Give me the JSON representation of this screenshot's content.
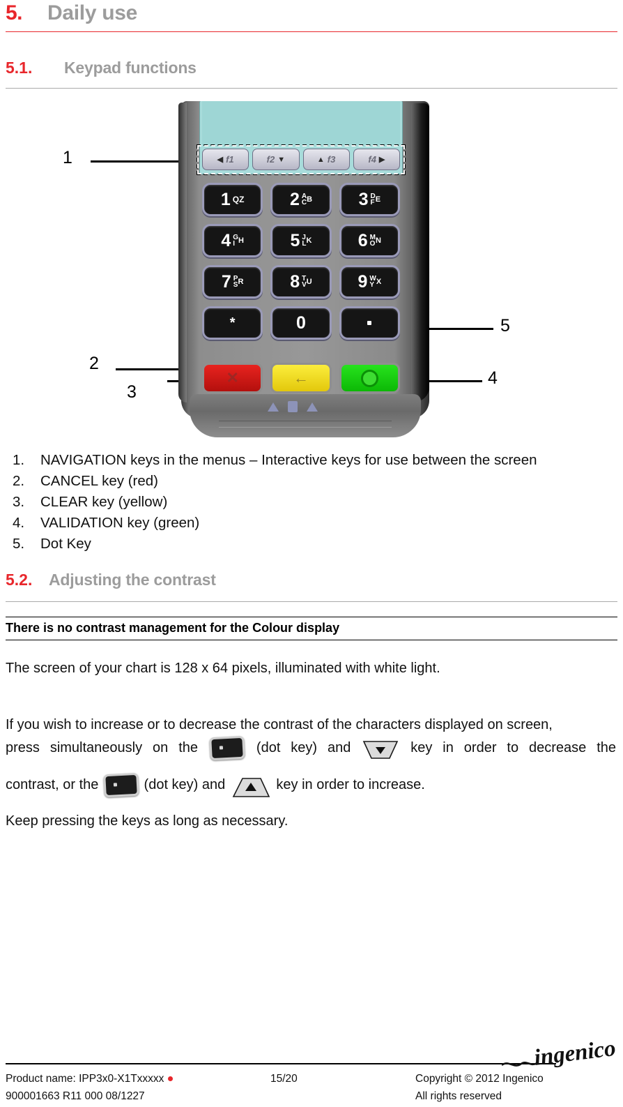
{
  "document": {
    "chapter": {
      "number": "5.",
      "title": "Daily use"
    },
    "sections": [
      {
        "number": "5.1.",
        "title": "Keypad functions"
      },
      {
        "number": "5.2.",
        "title": "Adjusting the contrast"
      }
    ]
  },
  "figure": {
    "alt": "IPP3x0 payment terminal keypad diagram",
    "callouts": [
      {
        "id": "1",
        "label": "1"
      },
      {
        "id": "2",
        "label": "2"
      },
      {
        "id": "3",
        "label": "3"
      },
      {
        "id": "4",
        "label": "4"
      },
      {
        "id": "5",
        "label": "5"
      }
    ],
    "function_keys": [
      {
        "arrow": "◀",
        "label": "f1",
        "arrow_side": "left"
      },
      {
        "arrow": "▼",
        "label": "f2",
        "arrow_side": "right"
      },
      {
        "arrow": "▲",
        "label": "f3",
        "arrow_side": "left"
      },
      {
        "arrow": "▶",
        "label": "f4",
        "arrow_side": "right"
      }
    ],
    "keys": [
      {
        "num": "1",
        "letters": [
          "Q",
          "Z"
        ],
        "style": "one"
      },
      {
        "num": "2",
        "letters": [
          "A",
          "C",
          "B"
        ],
        "style": "three"
      },
      {
        "num": "3",
        "letters": [
          "D",
          "F",
          "E"
        ],
        "style": "three"
      },
      {
        "num": "4",
        "letters": [
          "G",
          "I",
          "H"
        ],
        "style": "three"
      },
      {
        "num": "5",
        "letters": [
          "J",
          "L",
          "K"
        ],
        "style": "three"
      },
      {
        "num": "6",
        "letters": [
          "M",
          "O",
          "N"
        ],
        "style": "three"
      },
      {
        "num": "7",
        "letters": [
          "P",
          "S",
          "R"
        ],
        "style": "three"
      },
      {
        "num": "8",
        "letters": [
          "T",
          "V",
          "U"
        ],
        "style": "three"
      },
      {
        "num": "9",
        "letters": [
          "W",
          "Y",
          "X"
        ],
        "style": "three"
      },
      {
        "num": "*",
        "letters": [],
        "style": "star"
      },
      {
        "num": "0",
        "letters": [],
        "style": "plain"
      },
      {
        "num": ".",
        "letters": [],
        "style": "dot"
      }
    ],
    "control_keys": [
      {
        "name": "cancel",
        "color": "#e8231f",
        "glyph": "✕"
      },
      {
        "name": "clear",
        "color": "#fbed3c",
        "glyph": "←"
      },
      {
        "name": "validation",
        "color": "#27e31d",
        "glyph": "○"
      }
    ],
    "colors": {
      "cancel": "#e8231f",
      "clear": "#fbed3c",
      "validation": "#27e31d",
      "screen": "#a8dcdb"
    }
  },
  "key_list": [
    {
      "n": "1.",
      "text": "NAVIGATION keys in the menus – Interactive keys for use between the screen"
    },
    {
      "n": "2.",
      "text": "CANCEL key (red)"
    },
    {
      "n": "3.",
      "text": "CLEAR key (yellow)"
    },
    {
      "n": "4.",
      "text": "VALIDATION key (green)"
    },
    {
      "n": "5.",
      "text": "Dot Key"
    }
  ],
  "contrast": {
    "note": "There is no contrast management for the Colour display",
    "screen_spec": "The screen of your chart is 128 x 64 pixels, illuminated with white light.",
    "para_line1": "If you wish to increase or to decrease the contrast of the characters displayed on screen,",
    "para_seg1": "press simultaneously on the",
    "para_seg2": "(dot key) and",
    "para_seg3": "key in order to decrease the",
    "para_seg4": "contrast, or the",
    "para_seg5": "(dot key) and",
    "para_seg6": "key in order to increase.",
    "para_last": "Keep pressing the keys as long as necessary."
  },
  "footer": {
    "product_label": "Product name: IPP3x0-X1Txxxxx",
    "doc_ref": "900001663 R11 000 08/1227",
    "page": "15/20",
    "copyright": "Copyright © 2012 Ingenico",
    "rights": "All rights reserved",
    "logo_text": "ingenico"
  },
  "theme": {
    "accent_red": "#e8262b",
    "heading_gray": "#9c9c9c",
    "text_black": "#111111"
  }
}
